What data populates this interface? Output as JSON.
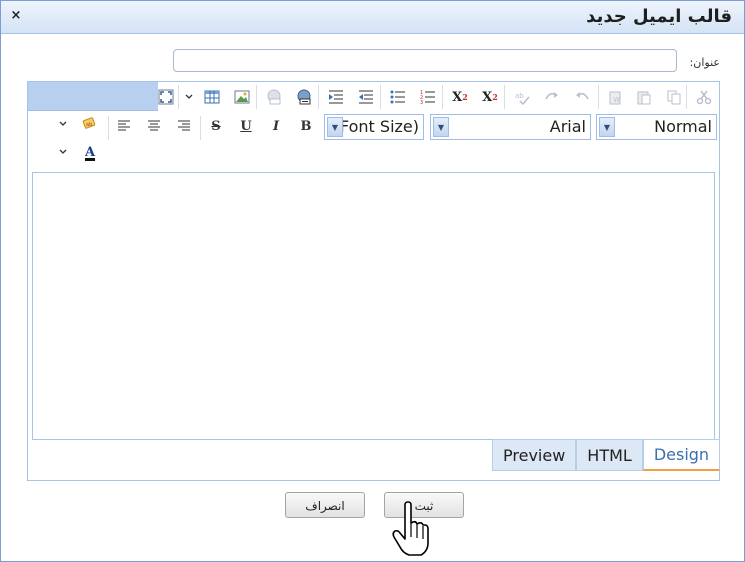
{
  "dialog": {
    "title": "قالب ایمیل جدید",
    "close_glyph": "×"
  },
  "subject": {
    "label": "عنوان:",
    "value": "",
    "placeholder": ""
  },
  "toolbar": {
    "font_name": "Arial",
    "font_size": "(Font Size)",
    "paragraph_format": "Normal",
    "buttons_row1": [
      "cut-icon",
      "copy-icon",
      "paste-icon",
      "paste-word-icon",
      "undo-icon",
      "redo-icon",
      "spellcheck-icon",
      "superscript-icon",
      "subscript-icon",
      "ordered-list-icon",
      "unordered-list-icon",
      "outdent-icon",
      "indent-icon",
      "insert-link-icon",
      "remove-link-icon",
      "insert-image-icon",
      "insert-table-icon",
      "fullscreen-icon"
    ],
    "superscript_glyph": "X",
    "subscript_glyph": "X",
    "sup_mark": "2",
    "sub_mark": "2",
    "bold_glyph": "B",
    "italic_glyph": "I",
    "underline_glyph": "U",
    "strike_glyph": "S",
    "font_color_glyph": "A"
  },
  "tabs": [
    {
      "label": "Design"
    },
    {
      "label": "HTML"
    },
    {
      "label": "Preview"
    }
  ],
  "actions": {
    "submit_label": "ثبت",
    "cancel_label": "انصراف"
  },
  "colors": {
    "accent": "#3a6fb0",
    "title_bar": "#d4e3f6",
    "tab_underline": "#f0a040"
  }
}
